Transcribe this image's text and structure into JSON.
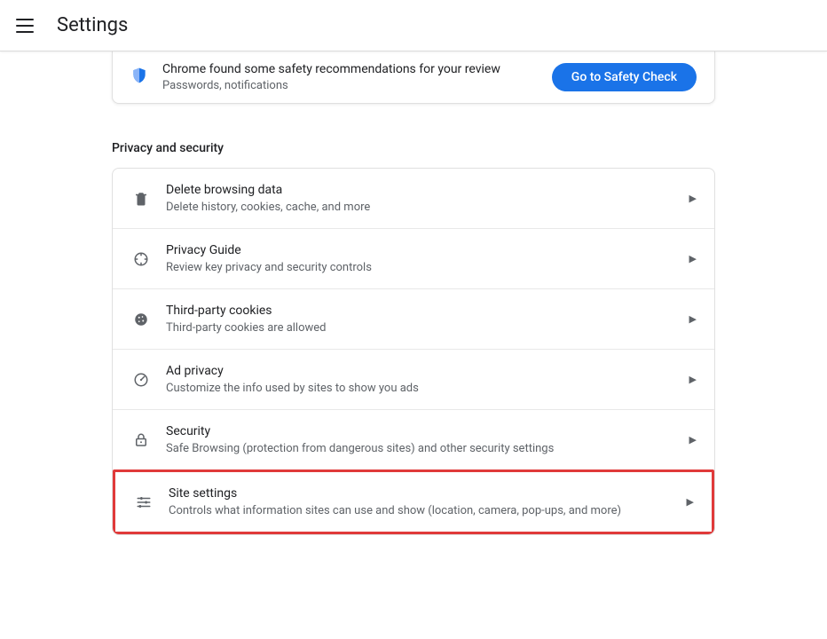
{
  "header": {
    "title": "Settings"
  },
  "safety": {
    "title": "Chrome found some safety recommendations for your review",
    "subtitle": "Passwords, notifications",
    "button": "Go to Safety Check"
  },
  "section": {
    "label": "Privacy and security"
  },
  "rows": {
    "delete": {
      "title": "Delete browsing data",
      "subtitle": "Delete history, cookies, cache, and more"
    },
    "guide": {
      "title": "Privacy Guide",
      "subtitle": "Review key privacy and security controls"
    },
    "cookies": {
      "title": "Third-party cookies",
      "subtitle": "Third-party cookies are allowed"
    },
    "adprivacy": {
      "title": "Ad privacy",
      "subtitle": "Customize the info used by sites to show you ads"
    },
    "security": {
      "title": "Security",
      "subtitle": "Safe Browsing (protection from dangerous sites) and other security settings"
    },
    "site": {
      "title": "Site settings",
      "subtitle": "Controls what information sites can use and show (location, camera, pop-ups, and more)"
    }
  }
}
